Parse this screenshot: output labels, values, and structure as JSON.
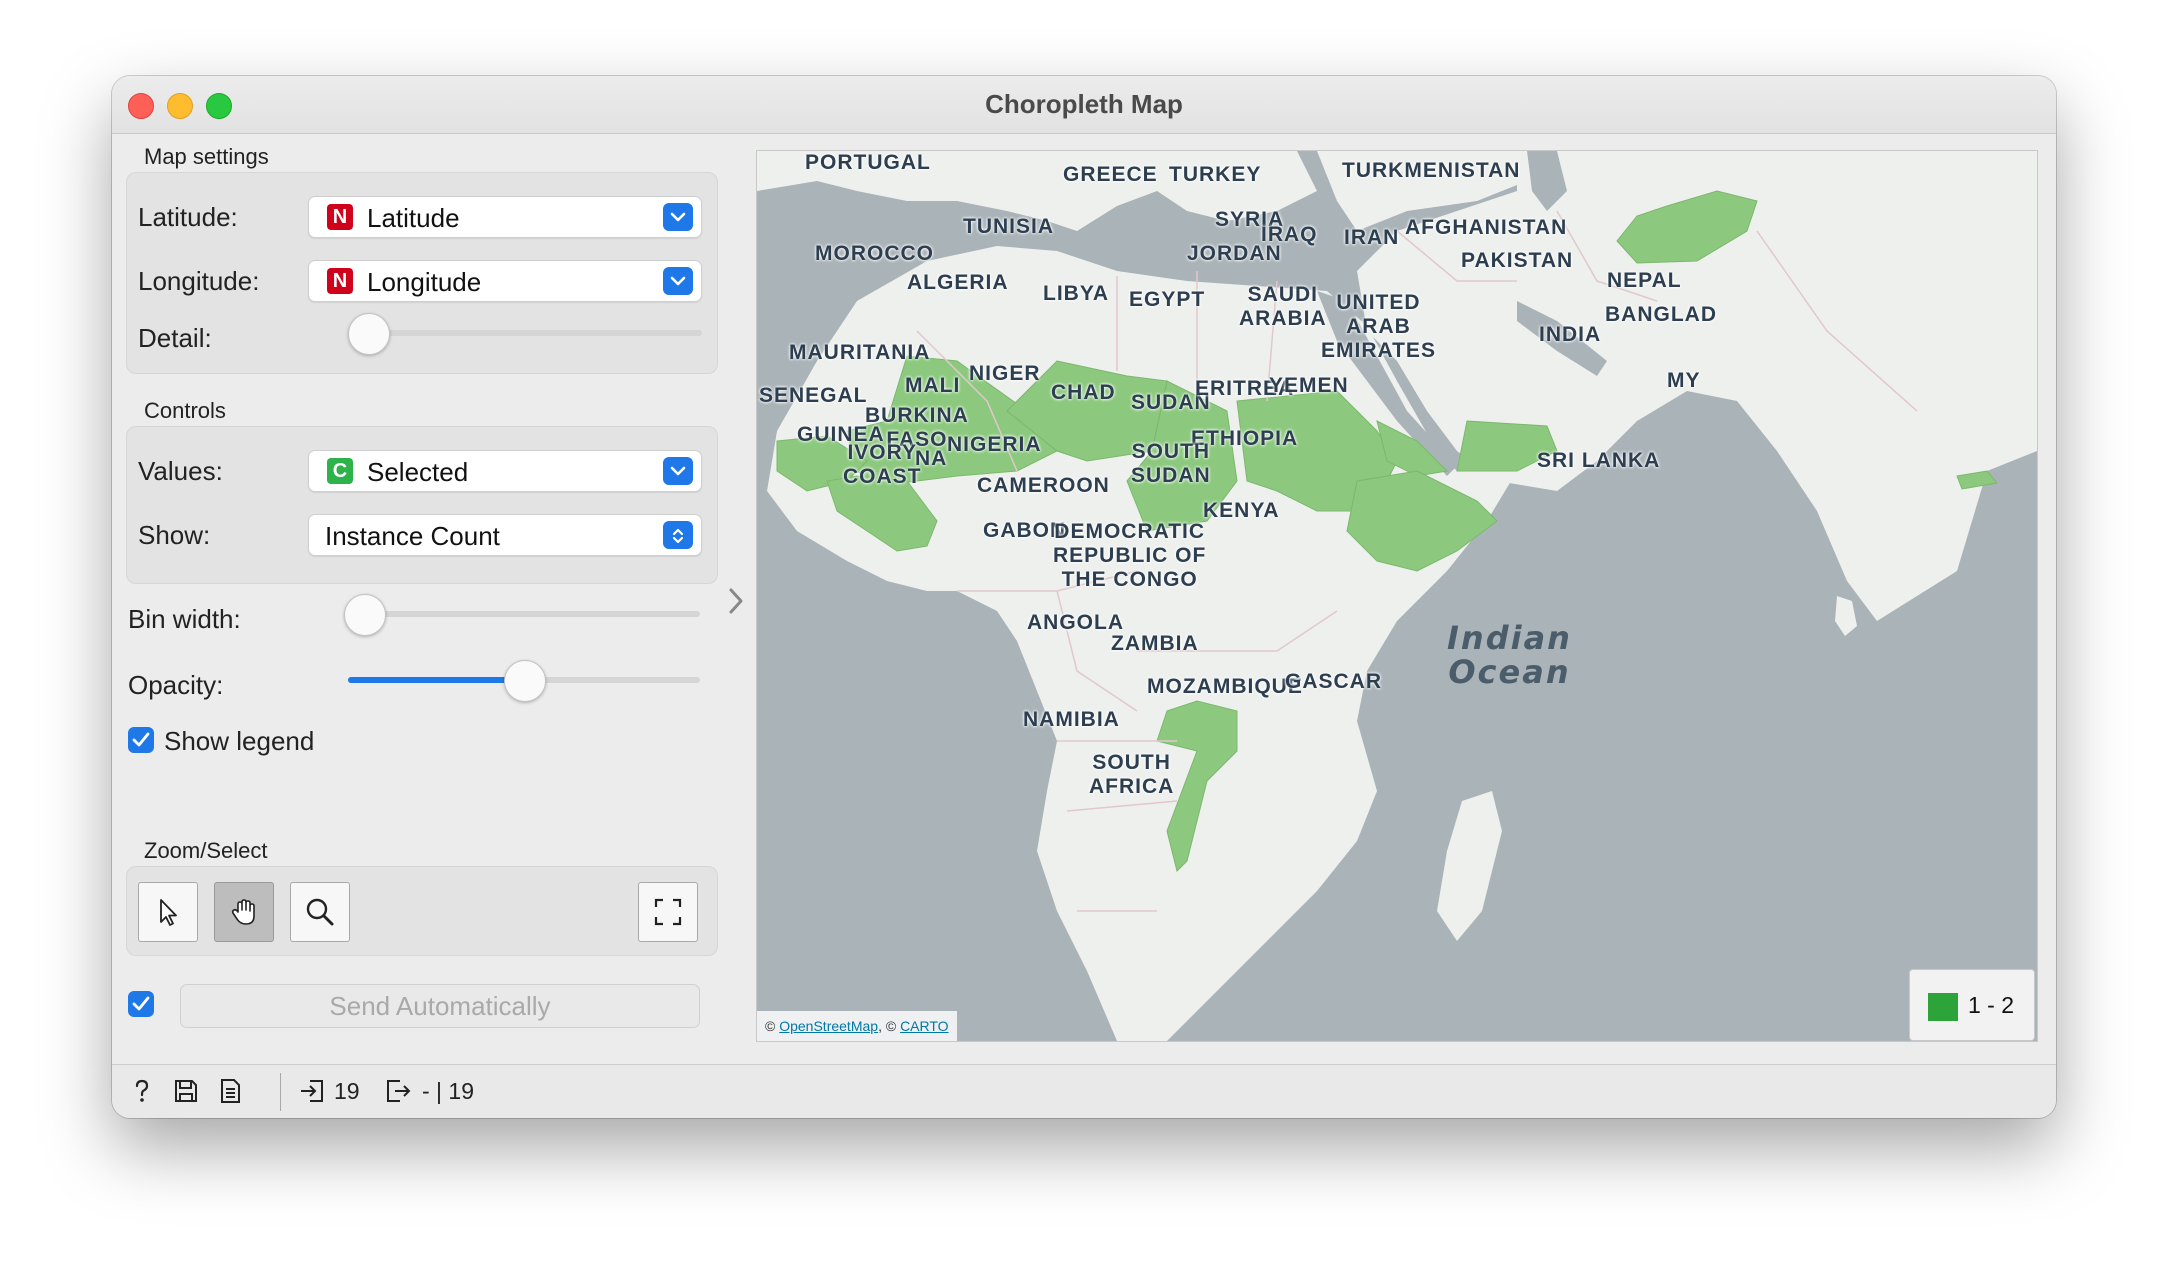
{
  "window": {
    "title": "Choropleth Map"
  },
  "map_settings": {
    "section_label": "Map settings",
    "latitude_label": "Latitude:",
    "latitude_value": "Latitude",
    "longitude_label": "Longitude:",
    "longitude_value": "Longitude",
    "detail_label": "Detail:",
    "detail_level": 0.0,
    "var_type_badge": "N"
  },
  "controls": {
    "section_label": "Controls",
    "values_label": "Values:",
    "values_value": "Selected",
    "values_type_badge": "C",
    "show_label": "Show:",
    "show_value": "Instance Count",
    "bin_width_label": "Bin width:",
    "bin_width_level": 0.0,
    "opacity_label": "Opacity:",
    "opacity_level": 0.5,
    "show_legend_label": "Show legend",
    "show_legend_checked": true
  },
  "zoom_select": {
    "section_label": "Zoom/Select",
    "tools": [
      "select-tool",
      "pan-tool",
      "zoom-tool"
    ],
    "active_tool": "pan-tool"
  },
  "send": {
    "label": "Send Automatically",
    "auto_checked": true
  },
  "status": {
    "input_count": "19",
    "output_count": "- | 19"
  },
  "map": {
    "attribution_prefix": "©",
    "attribution_osm": "OpenStreetMap",
    "attribution_sep": ", ©",
    "attribution_carto": "CARTO",
    "legend_label": "1 - 2",
    "legend_color": "#2da43a",
    "highlight_color": "#8cc97e",
    "country_labels": [
      "PORTUGAL",
      "GREECE",
      "TURKEY",
      "TURKMENISTAN",
      "SYRIA",
      "IRAQ",
      "IRAN",
      "AFGHANISTAN",
      "TUNISIA",
      "MOROCCO",
      "JORDAN",
      "PAKISTAN",
      "ALGERIA",
      "LIBYA",
      "EGYPT",
      "SAUDI\nARABIA",
      "UNITED\nARAB\nEMIRATES",
      "NEPAL",
      "BANGLAD",
      "INDIA",
      "MAURITANIA",
      "MALI",
      "NIGER",
      "CHAD",
      "SUDAN",
      "ERITREA",
      "YEMEN",
      "MY",
      "SENEGAL",
      "BURKINA\nFASO",
      "GUINEA",
      "IVORY\nCOAST",
      "NA",
      "NIGERIA",
      "ETHIOPIA",
      "SOUTH\nSUDAN",
      "SRI LANKA",
      "CAMEROON",
      "KENYA",
      "GABON",
      "DEMOCRATIC\nREPUBLIC OF\nTHE CONGO",
      "ANGOLA",
      "ZAMBIA",
      "MOZAMBIQUE",
      "GASCAR",
      "NAMIBIA",
      "SOUTH\nAFRICA"
    ],
    "ocean_label": "Indian\nOcean"
  }
}
